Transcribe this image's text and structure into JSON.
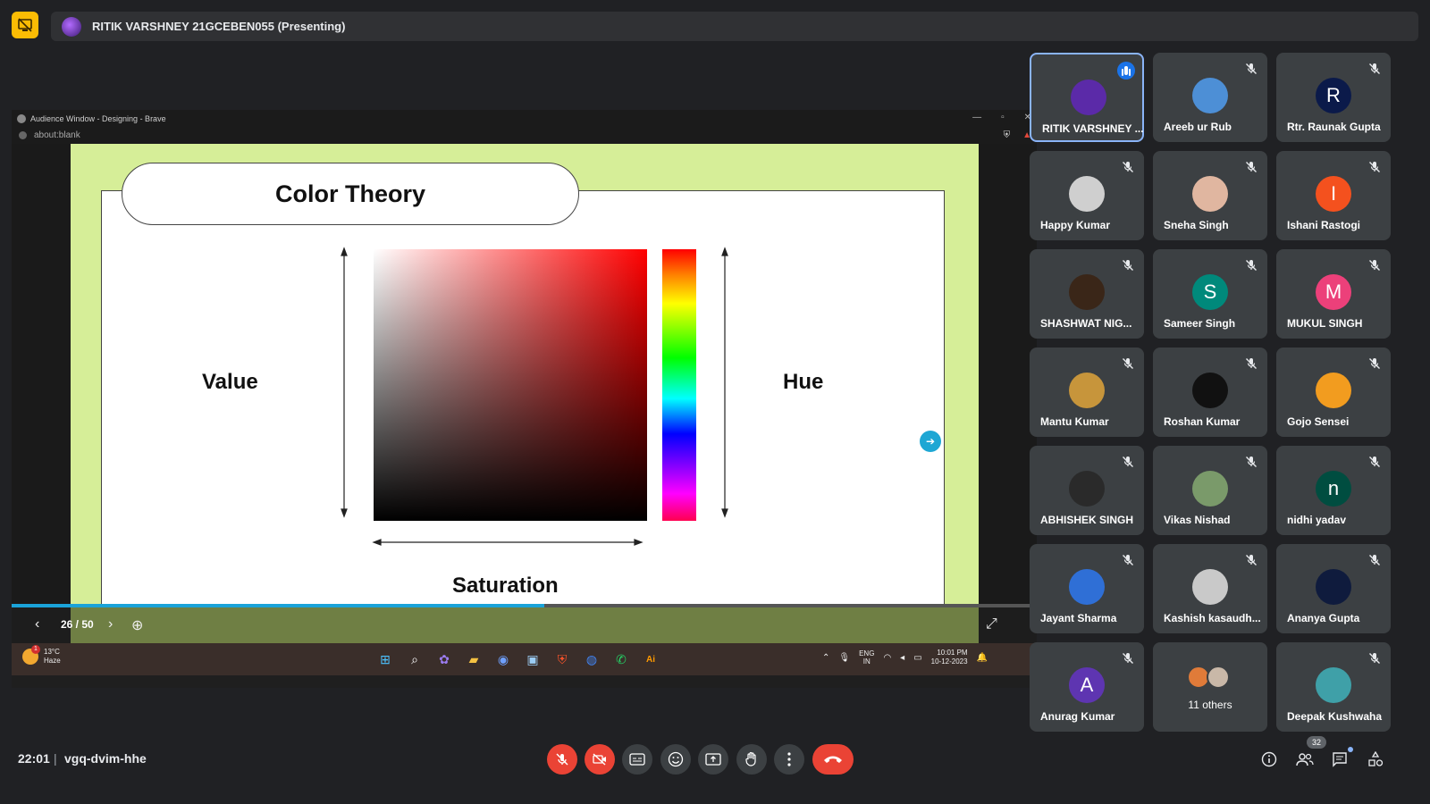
{
  "presenting": {
    "text": "RITIK VARSHNEY 21GCEBEN055 (Presenting)"
  },
  "shared_window": {
    "title": "Audience Window - Designing - Brave",
    "address": "about:blank",
    "slide": {
      "title": "Color Theory",
      "label_value": "Value",
      "label_hue": "Hue",
      "label_saturation": "Saturation",
      "page": "26 / 50",
      "progress": 0.52
    },
    "taskbar": {
      "temperature": "13°C",
      "weather": "Haze",
      "weather_badge": "1",
      "lang_line1": "ENG",
      "lang_line2": "IN",
      "time": "10:01 PM",
      "date": "10-12-2023"
    }
  },
  "participants": [
    {
      "name": "RITIK VARSHNEY ...",
      "initial": "",
      "color": "#5b2aa8",
      "active": true
    },
    {
      "name": "Areeb ur Rub",
      "initial": "",
      "color": "#4d8fd6"
    },
    {
      "name": "Rtr. Raunak Gupta",
      "initial": "R",
      "color": "#0b1a4a"
    },
    {
      "name": "Happy Kumar",
      "initial": "",
      "color": "#cfcfcf"
    },
    {
      "name": "Sneha Singh",
      "initial": "",
      "color": "#e0b6a0"
    },
    {
      "name": "Ishani Rastogi",
      "initial": "I",
      "color": "#f4511e"
    },
    {
      "name": "SHASHWAT NIG...",
      "initial": "",
      "color": "#3a2618"
    },
    {
      "name": "Sameer Singh",
      "initial": "S",
      "color": "#00897b"
    },
    {
      "name": "MUKUL SINGH",
      "initial": "M",
      "color": "#ec407a"
    },
    {
      "name": "Mantu Kumar",
      "initial": "",
      "color": "#c7953b"
    },
    {
      "name": "Roshan Kumar",
      "initial": "",
      "color": "#111111"
    },
    {
      "name": "Gojo Sensei",
      "initial": "",
      "color": "#f29c1f"
    },
    {
      "name": "ABHISHEK SINGH",
      "initial": "",
      "color": "#2a2a2a"
    },
    {
      "name": "Vikas Nishad",
      "initial": "",
      "color": "#7a9a6a"
    },
    {
      "name": "nidhi yadav",
      "initial": "n",
      "color": "#004d40"
    },
    {
      "name": "Jayant Sharma",
      "initial": "",
      "color": "#2f6fd6"
    },
    {
      "name": "Kashish kasaudh...",
      "initial": "",
      "color": "#c9c9c9"
    },
    {
      "name": "Ananya Gupta",
      "initial": "",
      "color": "#0f1b3d"
    },
    {
      "name": "Anurag Kumar",
      "initial": "A",
      "color": "#5e35b1"
    },
    {
      "name": "11 others",
      "initial": "",
      "color": ""
    },
    {
      "name": "Deepak Kushwaha",
      "initial": "",
      "color": "#3fa0a8"
    }
  ],
  "bottom": {
    "time": "22:01",
    "separator": "|",
    "code": "vgq-dvim-hhe",
    "people_count": "32"
  },
  "colors": {
    "accent": "#8ab4f8",
    "danger": "#ea4335",
    "background": "#202124",
    "slide_bg": "#d6ee98"
  }
}
